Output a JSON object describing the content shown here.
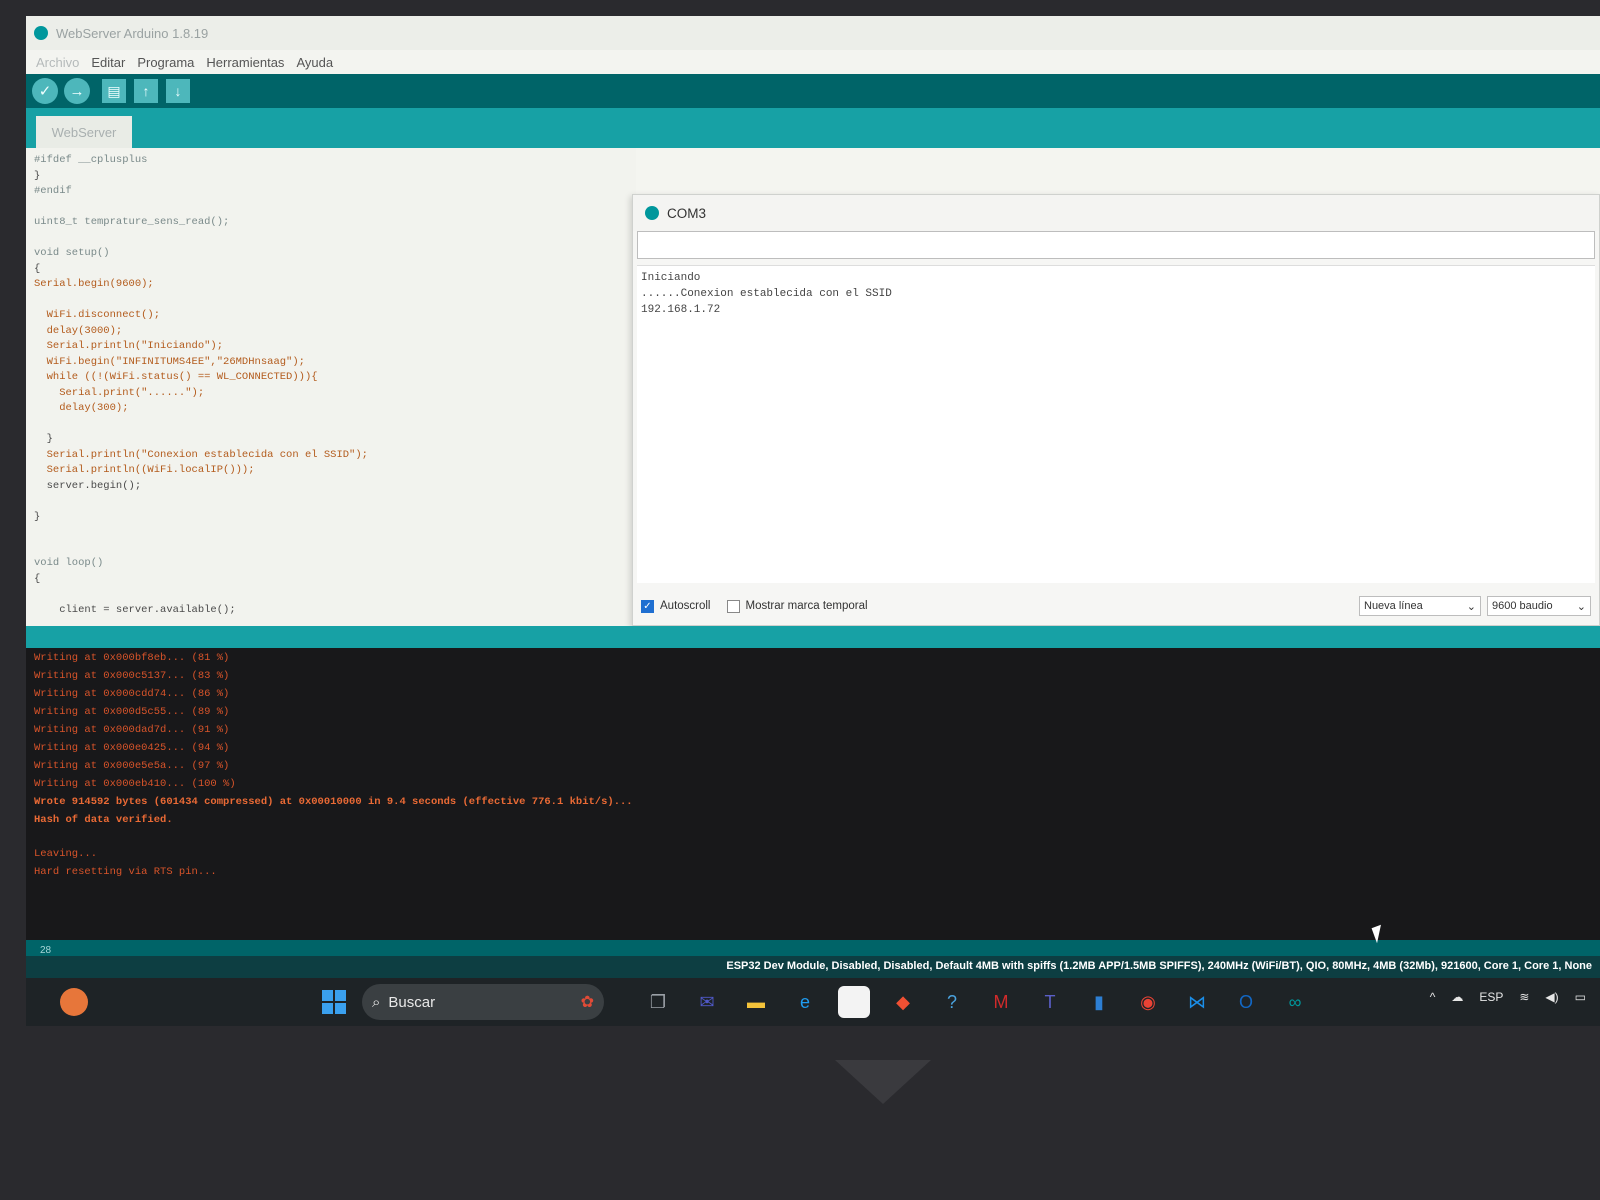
{
  "window": {
    "title": "WebServer Arduino 1.8.19"
  },
  "menu": [
    "Archivo",
    "Editar",
    "Programa",
    "Herramientas",
    "Ayuda"
  ],
  "toolbar": {
    "verify_icon": "✓",
    "upload_icon": "→",
    "new_icon": "▤",
    "open_icon": "↑",
    "save_icon": "↓"
  },
  "tab": {
    "label": "WebServer"
  },
  "editor": {
    "lines": [
      "#ifdef __cplusplus",
      "}",
      "#endif",
      "",
      "uint8_t temprature_sens_read();",
      "",
      "void setup()",
      "{",
      "Serial.begin(9600);",
      "",
      "  WiFi.disconnect();",
      "  delay(3000);",
      "  Serial.println(\"Iniciando\");",
      "  WiFi.begin(\"INFINITUMS4EE\",\"26MDHnsaag\");",
      "  while ((!(WiFi.status() == WL_CONNECTED))){",
      "    Serial.print(\"......\");",
      "    delay(300);",
      "",
      "  }",
      "  Serial.println(\"Conexion establecida con el SSID\");",
      "  Serial.println((WiFi.localIP()));",
      "  server.begin();",
      "",
      "}",
      "",
      "",
      "void loop()",
      "{",
      "",
      "    client = server.available();"
    ]
  },
  "serial_monitor": {
    "title": "COM3",
    "input_value": "",
    "output": [
      "Iniciando",
      "......Conexion establecida con el SSID",
      "192.168.1.72"
    ],
    "autoscroll_label": "Autoscroll",
    "autoscroll_checked": true,
    "timestamp_label": "Mostrar marca temporal",
    "timestamp_checked": false,
    "line_ending": "Nueva línea",
    "baud": "9600 baudio"
  },
  "console": {
    "lines": [
      "Writing at 0x000bf8eb... (81 %)",
      "Writing at 0x000c5137... (83 %)",
      "Writing at 0x000cdd74... (86 %)",
      "Writing at 0x000d5c55... (89 %)",
      "Writing at 0x000dad7d... (91 %)",
      "Writing at 0x000e0425... (94 %)",
      "Writing at 0x000e5e5a... (97 %)",
      "Writing at 0x000eb410... (100 %)",
      "Wrote 914592 bytes (601434 compressed) at 0x00010000 in 9.4 seconds (effective 776.1 kbit/s)...",
      "Hash of data verified.",
      "",
      "Leaving...",
      "Hard resetting via RTS pin..."
    ]
  },
  "status": {
    "line_number": "28",
    "board": "ESP32 Dev Module, Disabled, Disabled, Default 4MB with spiffs (1.2MB APP/1.5MB SPIFFS), 240MHz (WiFi/BT), QIO, 80MHz, 4MB (32Mb), 921600, Core 1, Core 1, None"
  },
  "taskbar": {
    "search_label": "Buscar",
    "language": "ESP",
    "apps": [
      "task-view-icon",
      "teams-chat-icon",
      "file-explorer-icon",
      "edge-icon",
      "store-icon",
      "git-icon",
      "help-icon",
      "mcafee-icon",
      "teams-icon",
      "notes-icon",
      "chrome-icon",
      "vscode-icon",
      "outlook-icon",
      "arduino-icon"
    ]
  },
  "colors": {
    "arduino_teal": "#00979c",
    "toolbar_dark": "#006468",
    "console_text": "#d8542a",
    "console_bg": "#18181a"
  }
}
